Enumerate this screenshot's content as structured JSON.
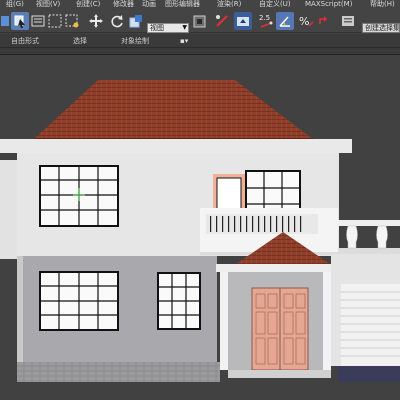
{
  "menubar": {
    "items": [
      {
        "label": "组(G)"
      },
      {
        "label": "视图(V)"
      },
      {
        "label": "创建(C)"
      },
      {
        "label": "修改器"
      },
      {
        "label": "动画"
      },
      {
        "label": "图形编辑器"
      },
      {
        "label": "渲染(R)"
      },
      {
        "label": "自定义(U)"
      },
      {
        "label": "MAXScript(M)"
      },
      {
        "label": "帮助(H)"
      }
    ]
  },
  "toolbar": {
    "view_select_value": "视图",
    "snap_angle_label": "2.5",
    "search_placeholder": "创建选择集"
  },
  "ribbon": {
    "tabs": [
      {
        "label": "自由形式"
      },
      {
        "label": "选择"
      },
      {
        "label": "对象绘制"
      }
    ],
    "toggle_label": "▪▾"
  },
  "colors": {
    "ui_bg": "#444444",
    "viewport_bg": "#414141",
    "wall": "#e8e8e8",
    "wall_lower": "#a9a9ad",
    "roof": "#8e3d28",
    "door": "#e4a58f",
    "window_glass": "#f4f4f4",
    "window_frame": "#111111",
    "accent_blue": "#2f6fd6"
  },
  "icons": [
    "select-object-icon",
    "select-by-name-icon",
    "rect-selection-region-icon",
    "window-crossing-icon",
    "select-and-move-icon",
    "select-and-rotate-icon",
    "select-and-scale-icon",
    "pivot-center-icon",
    "select-and-manipulate-icon",
    "keyboard-shortcut-override-icon",
    "snaps-toggle-icon",
    "angle-snap-icon",
    "percent-snap-icon",
    "spinner-snap-icon",
    "edit-named-selection-icon"
  ]
}
